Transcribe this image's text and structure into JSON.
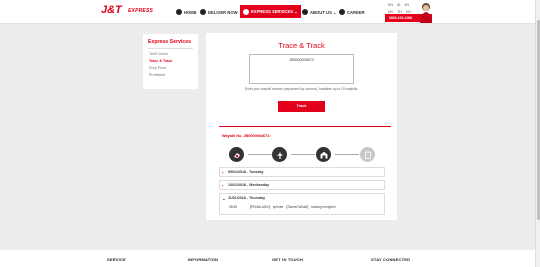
{
  "header": {
    "logo_text": "J&T",
    "logo_sub": "EXPRESS",
    "nav": [
      {
        "label": "HOME",
        "icon": "home-icon"
      },
      {
        "label": "DELIVER NOW",
        "icon": "deliver-icon"
      },
      {
        "label": "EXPRESS SERVICES ⌄",
        "icon": "services-icon",
        "active": true
      },
      {
        "label": "ABOUT US ⌄",
        "icon": "about-icon"
      },
      {
        "label": "CAREER",
        "icon": "career-icon"
      }
    ],
    "languages": [
      "EN",
      "ID",
      "ZH"
    ],
    "languages_row2": [
      "MY",
      "TH",
      "VN"
    ],
    "hotline": "0800-100-1188"
  },
  "sidebar": {
    "title": "Express Services",
    "items": [
      {
        "label": "Tariff Check"
      },
      {
        "label": "Trace & Track",
        "active": true
      },
      {
        "label": "Drop Point"
      },
      {
        "label": "Prohibited"
      }
    ]
  },
  "main": {
    "title": "Trace & Track",
    "input_value": "JB0000004672",
    "hint": "Enter your waybill number (separated by comma). Available up to 10 waybills.",
    "track_label": "Track",
    "waybill_label": "Waybill No. JB0000004672:",
    "steps": [
      "pickup",
      "departure",
      "arrival",
      "delivered"
    ],
    "days": [
      {
        "label": "09/01/2018 - Tuesday"
      },
      {
        "label": "10/01/2018 - Wednesday"
      },
      {
        "label": "11/01/2018 - Thursday",
        "time": "08:58",
        "detail": "【PEMALANG】 sprinter 【Slamet Wiludi】 sedang mengirim"
      }
    ]
  },
  "footer": {
    "columns": [
      "SERVICE",
      "INFORMATION",
      "GET IN TOUCH",
      "STAY CONNECTED"
    ]
  },
  "colors": {
    "brand": "#e2001a",
    "dark": "#333333",
    "muted": "#c7c7c7"
  }
}
